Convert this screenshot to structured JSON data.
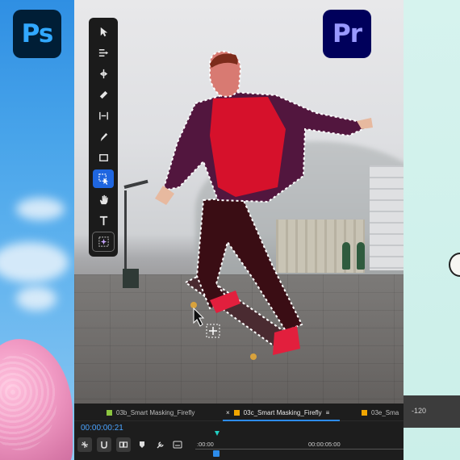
{
  "apps": {
    "photoshop_logo": "Ps",
    "premiere_logo": "Pr"
  },
  "toolbar": {
    "tools": [
      {
        "name": "selection-tool",
        "icon": "arrow-cursor-icon",
        "active": false
      },
      {
        "name": "track-select-tool",
        "icon": "track-select-icon",
        "active": false
      },
      {
        "name": "ripple-edit-tool",
        "icon": "ripple-edit-icon",
        "active": false
      },
      {
        "name": "razor-tool",
        "icon": "razor-icon",
        "active": false
      },
      {
        "name": "slip-tool",
        "icon": "slip-icon",
        "active": false
      },
      {
        "name": "pen-tool",
        "icon": "pen-icon",
        "active": false
      },
      {
        "name": "rectangle-tool",
        "icon": "rectangle-icon",
        "active": false
      },
      {
        "name": "object-select-tool",
        "icon": "object-select-icon",
        "active": true
      },
      {
        "name": "hand-tool",
        "icon": "hand-icon",
        "active": false
      },
      {
        "name": "type-tool",
        "icon": "type-icon",
        "active": false
      },
      {
        "name": "generative-tool",
        "icon": "sparkle-select-icon",
        "active": false
      }
    ],
    "active_color": "#1f66e0"
  },
  "timeline": {
    "tabs": [
      {
        "label": "03b_Smart Masking_Firefly",
        "swatch": "#8cc63f",
        "active": false
      },
      {
        "label": "03c_Smart Masking_Firefly",
        "swatch": "#f0a500",
        "active": true,
        "close": "×",
        "menu": "≡"
      },
      {
        "label": "03e_Sma",
        "swatch": "#f0a500",
        "active": false
      }
    ],
    "timecode": "00:00:00:21",
    "ruler_start": ":00:00",
    "ruler_mark": "00:00:05:00",
    "tab_underline_color": "#2d8ceb",
    "playhead_color": "#22d0c4"
  },
  "right_panel": {
    "ruler_value": "-120"
  }
}
